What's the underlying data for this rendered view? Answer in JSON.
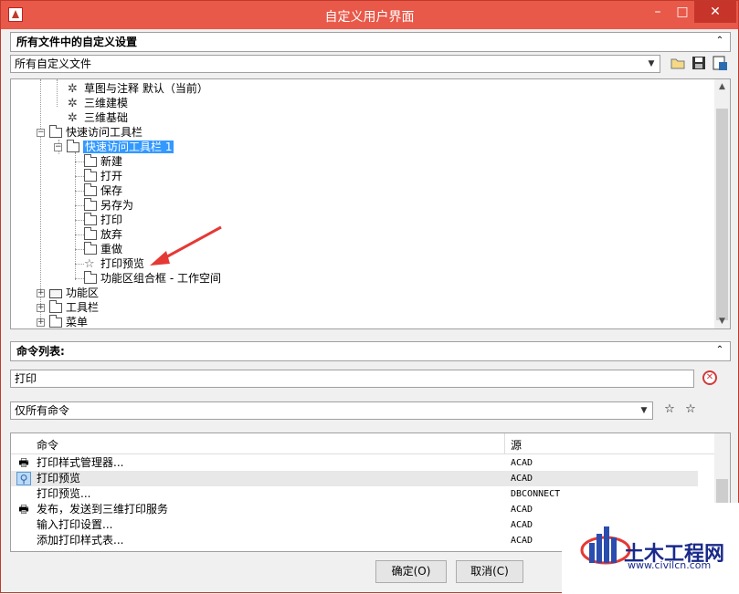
{
  "window": {
    "title": "自定义用户界面",
    "min_label": "–",
    "max_label": "□",
    "close_label": "✕"
  },
  "top_panel": {
    "header": "所有文件中的自定义设置",
    "collapse": "⌃",
    "file_select": "所有自定义文件",
    "tree": [
      {
        "label": "草图与注释 默认（当前）",
        "icon": "gear-icon"
      },
      {
        "label": "三维建模",
        "icon": "gear-icon"
      },
      {
        "label": "三维基础",
        "icon": "gear-icon"
      },
      {
        "label": "快速访问工具栏",
        "icon": "toolbar-icon"
      },
      {
        "label": "快速访问工具栏 1",
        "icon": "toolbar-icon"
      },
      {
        "label": "新建",
        "icon": "command-icon"
      },
      {
        "label": "打开",
        "icon": "command-icon"
      },
      {
        "label": "保存",
        "icon": "command-icon"
      },
      {
        "label": "另存为",
        "icon": "command-icon"
      },
      {
        "label": "打印",
        "icon": "command-icon"
      },
      {
        "label": "放弃",
        "icon": "command-icon"
      },
      {
        "label": "重做",
        "icon": "command-icon"
      },
      {
        "label": "打印预览",
        "icon": "star-icon"
      },
      {
        "label": "功能区组合框 - 工作空间",
        "icon": "command-icon"
      },
      {
        "label": "功能区",
        "icon": "folder-icon"
      },
      {
        "label": "工具栏",
        "icon": "toolbar-icon"
      },
      {
        "label": "菜单",
        "icon": "menu-icon"
      }
    ]
  },
  "command_panel": {
    "header": "命令列表:",
    "search_value": "打印",
    "filter_select": "仅所有命令",
    "columns": {
      "command": "命令",
      "source": "源"
    },
    "rows": [
      {
        "name": "打印样式管理器...",
        "source": "ACAD",
        "icon": "plot-style-icon"
      },
      {
        "name": "打印预览",
        "source": "ACAD",
        "icon": "preview-icon"
      },
      {
        "name": "打印预览...",
        "source": "DBCONNECT",
        "icon": ""
      },
      {
        "name": "发布，发送到三维打印服务",
        "source": "ACAD",
        "icon": "3d-print-icon"
      },
      {
        "name": "输入打印设置...",
        "source": "ACAD",
        "icon": ""
      },
      {
        "name": "添加打印样式表...",
        "source": "ACAD",
        "icon": ""
      }
    ]
  },
  "buttons": {
    "ok": "确定(O)",
    "cancel": "取消(C)"
  },
  "watermark": {
    "title": "土木工程网",
    "url": "www.civilcn.com"
  },
  "colors": {
    "title_bar": "#e8594a",
    "selection": "#3399ff",
    "arrow": "#e53935",
    "watermark_text": "#1a2a8a"
  }
}
